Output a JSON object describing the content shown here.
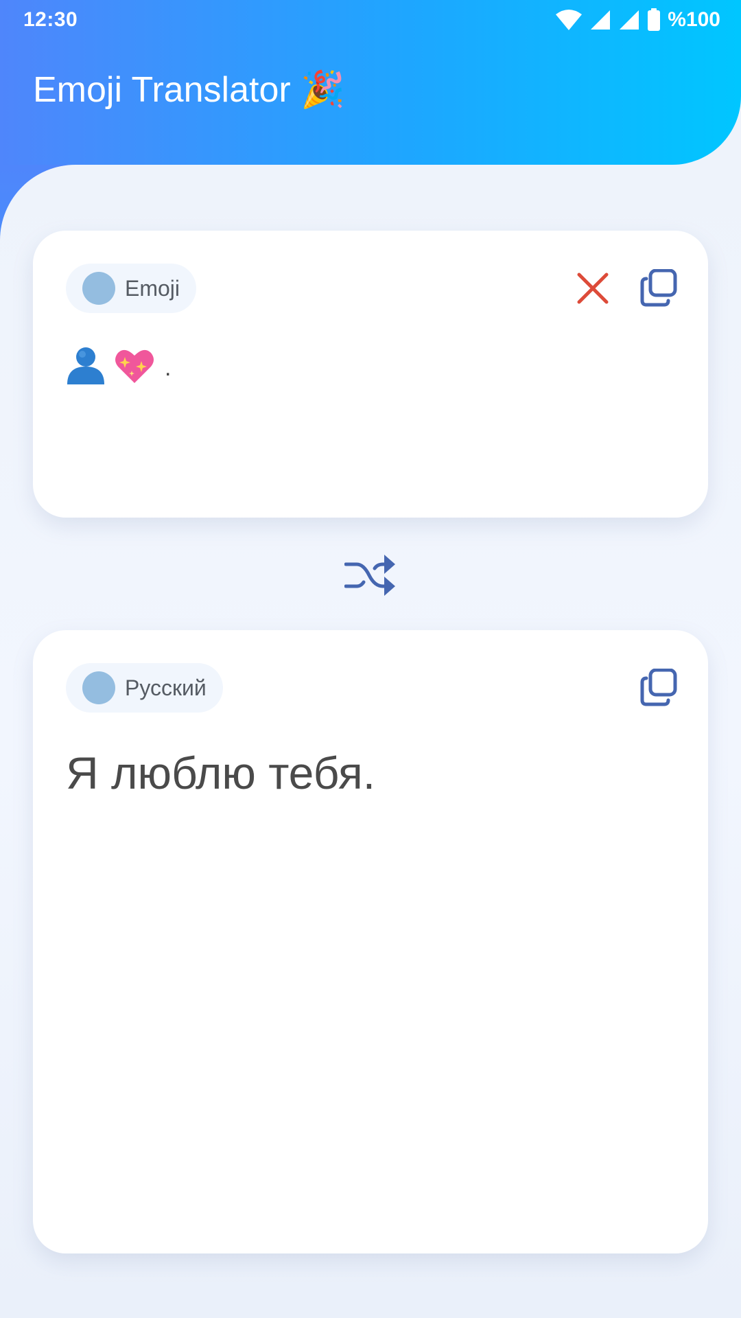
{
  "status_bar": {
    "time": "12:30",
    "battery": "%100"
  },
  "app": {
    "title": "Emoji Translator 🎉"
  },
  "source": {
    "language": "Emoji",
    "text_end": ".",
    "emojis": [
      "bust-in-silhouette",
      "sparkling-heart"
    ]
  },
  "target": {
    "language": "Русский",
    "text": "Я люблю тебя."
  },
  "colors": {
    "accent": "#4566b0",
    "clear": "#dd4b39",
    "header_start": "#4f86fb",
    "header_end": "#00c6ff",
    "chip_dot": "#94bde0"
  },
  "icons": {
    "clear": "close-icon",
    "copy": "copy-icon",
    "swap": "shuffle-icon"
  }
}
